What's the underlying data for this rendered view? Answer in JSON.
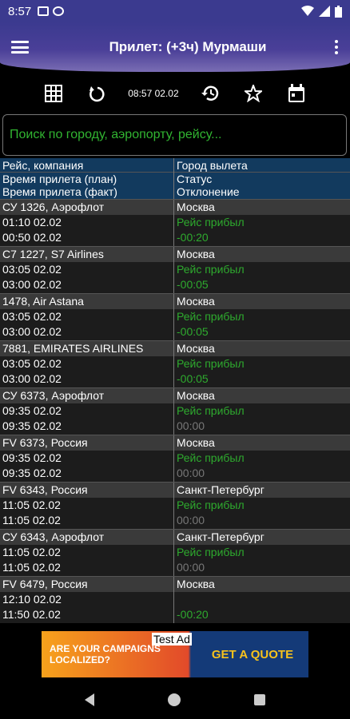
{
  "statusbar": {
    "time": "8:57"
  },
  "appbar": {
    "title": "Прилет: (+3ч) Мурмаши"
  },
  "toolbar": {
    "datetime": "08:57 02.02"
  },
  "search": {
    "placeholder": "Поиск по городу, аэропорту, рейсу..."
  },
  "header": {
    "col1_line1": "Рейс, компания",
    "col2_line1": "Город вылета",
    "col1_line2": "Время прилета (план)",
    "col1_line3": "Время прилета (факт)",
    "col2_line2": "Статус",
    "col2_line3": "Отклонение"
  },
  "flights": [
    {
      "flight": "СУ 1326, Аэрофлот",
      "city": "Москва",
      "plan": "01:10 02.02",
      "fact": "00:50 02.02",
      "status": "Рейс прибыл",
      "deviation": "-00:20"
    },
    {
      "flight": "С7 1227, S7 Airlines",
      "city": "Москва",
      "plan": "03:05 02.02",
      "fact": "03:00 02.02",
      "status": "Рейс прибыл",
      "deviation": "-00:05"
    },
    {
      "flight": "1478, Air Astana",
      "city": "Москва",
      "plan": "03:05 02.02",
      "fact": "03:00 02.02",
      "status": "Рейс прибыл",
      "deviation": "-00:05"
    },
    {
      "flight": "7881, EMIRATES AIRLINES",
      "city": "Москва",
      "plan": "03:05 02.02",
      "fact": "03:00 02.02",
      "status": "Рейс прибыл",
      "deviation": "-00:05"
    },
    {
      "flight": "СУ 6373, Аэрофлот",
      "city": "Москва",
      "plan": "09:35 02.02",
      "fact": "09:35 02.02",
      "status": "Рейс прибыл",
      "deviation": "00:00"
    },
    {
      "flight": "FV 6373, Россия",
      "city": "Москва",
      "plan": "09:35 02.02",
      "fact": "09:35 02.02",
      "status": "Рейс прибыл",
      "deviation": "00:00"
    },
    {
      "flight": "FV 6343, Россия",
      "city": "Санкт-Петербург",
      "plan": "11:05 02.02",
      "fact": "11:05 02.02",
      "status": "Рейс прибыл",
      "deviation": "00:00"
    },
    {
      "flight": "СУ 6343, Аэрофлот",
      "city": "Санкт-Петербург",
      "plan": "11:05 02.02",
      "fact": "11:05 02.02",
      "status": "Рейс прибыл",
      "deviation": "00:00"
    },
    {
      "flight": "FV 6479, Россия",
      "city": "Москва",
      "plan": "12:10 02.02",
      "fact": "11:50 02.02",
      "status": "",
      "deviation": "-00:20"
    }
  ],
  "ad": {
    "label": "Test Ad",
    "left_text": "ARE YOUR CAMPAIGNS LOCALIZED?",
    "right_text": "GET A QUOTE"
  },
  "colors": {
    "status_green": "#2eaa2e",
    "deviation_zero": "#777777",
    "header_bg": "#123a5e"
  }
}
